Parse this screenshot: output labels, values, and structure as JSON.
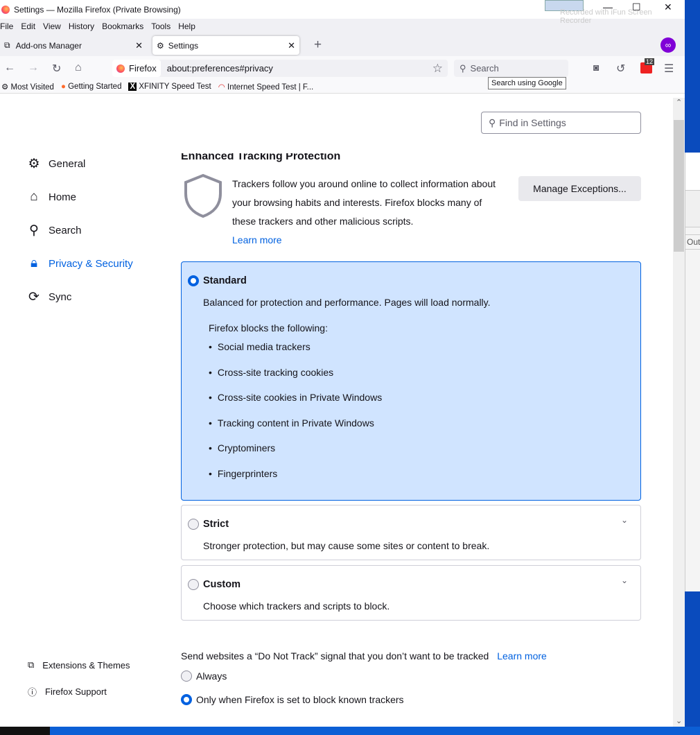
{
  "window": {
    "title": "Settings — Mozilla Firefox (Private Browsing)",
    "watermark": "Recorded with iFun Screen Recorder",
    "minimize": "—",
    "maximize": "☐",
    "close": "✕"
  },
  "menu": [
    "File",
    "Edit",
    "View",
    "History",
    "Bookmarks",
    "Tools",
    "Help"
  ],
  "tabs": [
    {
      "label": "Add-ons Manager",
      "icon": "puzzle-icon",
      "active": false
    },
    {
      "label": "Settings",
      "icon": "gear-icon",
      "active": true
    }
  ],
  "new_tab": "+",
  "navbar": {
    "identity": "Firefox",
    "url": "about:preferences#privacy",
    "search_placeholder": "Search",
    "tooltip": "Search using Google",
    "badge": "12"
  },
  "bookmarks": [
    "Most Visited",
    "Getting Started",
    "XFINITY Speed Test",
    "Internet Speed Test | F..."
  ],
  "find_placeholder": "Find in Settings",
  "categories": [
    {
      "label": "General",
      "icon": "gear-icon"
    },
    {
      "label": "Home",
      "icon": "home-icon"
    },
    {
      "label": "Search",
      "icon": "search-icon"
    },
    {
      "label": "Privacy & Security",
      "icon": "lock-icon",
      "selected": true
    },
    {
      "label": "Sync",
      "icon": "sync-icon"
    }
  ],
  "footer": [
    {
      "label": "Extensions & Themes",
      "icon": "puzzle-icon"
    },
    {
      "label": "Firefox Support",
      "icon": "help-icon"
    }
  ],
  "etp": {
    "heading": "Enhanced Tracking Protection",
    "description": "Trackers follow you around online to collect information about your browsing habits and interests. Firefox blocks many of these trackers and other malicious scripts.",
    "learn_more": "Learn more",
    "manage": "Manage Exceptions..."
  },
  "standard": {
    "title": "Standard",
    "desc": "Balanced for protection and performance. Pages will load normally.",
    "blocks_heading": "Firefox blocks the following:",
    "items": [
      "Social media trackers",
      "Cross-site tracking cookies",
      "Cross-site cookies in Private Windows",
      "Tracking content in Private Windows",
      "Cryptominers",
      "Fingerprinters"
    ],
    "selected": true
  },
  "strict": {
    "title": "Strict",
    "desc": "Stronger protection, but may cause some sites or content to break."
  },
  "custom": {
    "title": "Custom",
    "desc": "Choose which trackers and scripts to block."
  },
  "dnt": {
    "label": "Send websites a “Do Not Track” signal that you don’t want to be tracked",
    "learn_more": "Learn more",
    "options": [
      "Always",
      "Only when Firefox is set to block known trackers"
    ],
    "selected": 1
  },
  "background_window": {
    "text": "Out"
  },
  "colors": {
    "accent": "#0061e0",
    "selected_bg": "#d0e4ff"
  }
}
